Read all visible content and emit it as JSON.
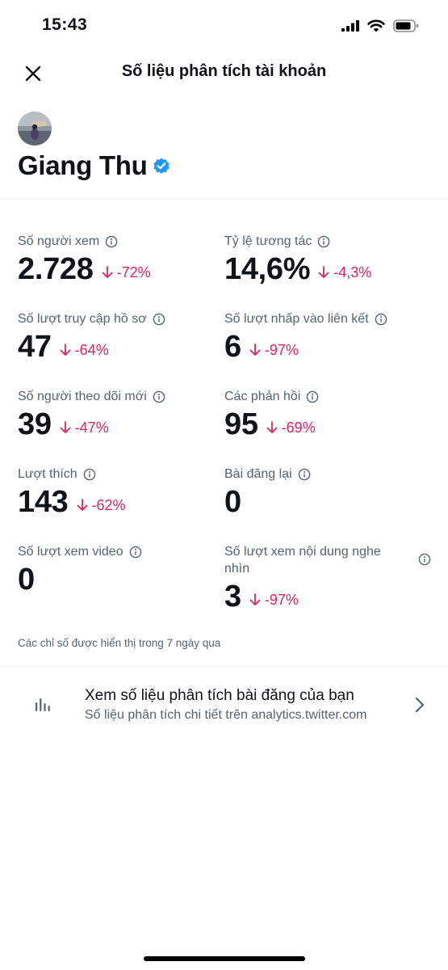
{
  "status_bar": {
    "time": "15:43"
  },
  "header": {
    "title": "Số liệu phân tích tài khoản"
  },
  "profile": {
    "name": "Giang Thu"
  },
  "metrics": [
    {
      "label": "Số người xem",
      "value": "2.728",
      "change": "-72%"
    },
    {
      "label": "Tỷ lệ tương tác",
      "value": "14,6%",
      "change": "-4,3%"
    },
    {
      "label": "Số lượt truy cập hồ sơ",
      "value": "47",
      "change": "-64%"
    },
    {
      "label": "Số lượt nhấp vào liên kết",
      "value": "6",
      "change": "-97%"
    },
    {
      "label": "Số người theo dõi mới",
      "value": "39",
      "change": "-47%"
    },
    {
      "label": "Các phản hồi",
      "value": "95",
      "change": "-69%"
    },
    {
      "label": "Lượt thích",
      "value": "143",
      "change": "-62%"
    },
    {
      "label": "Bài đăng lại",
      "value": "0",
      "change": ""
    },
    {
      "label": "Số lượt xem video",
      "value": "0",
      "change": ""
    },
    {
      "label_line1": "Số lượt xem nội dung nghe",
      "label_line2": "nhìn",
      "value": "3",
      "change": "-97%"
    }
  ],
  "footnote": "Các chỉ số được hiển thị trong 7 ngày qua",
  "analytics_link": {
    "title": "Xem số liệu phân tích bài đăng của bạn",
    "subtitle": "Số liệu phân tích chi tiết trên analytics.twitter.com"
  },
  "colors": {
    "negative": "#e0245e",
    "verified": "#1d9bf0",
    "secondary_text": "#536471"
  },
  "icons": [
    "close-icon",
    "verified-badge-icon",
    "info-icon",
    "down-arrow-icon",
    "bar-chart-icon",
    "chevron-right-icon",
    "signal-icon",
    "wifi-icon",
    "battery-icon"
  ]
}
